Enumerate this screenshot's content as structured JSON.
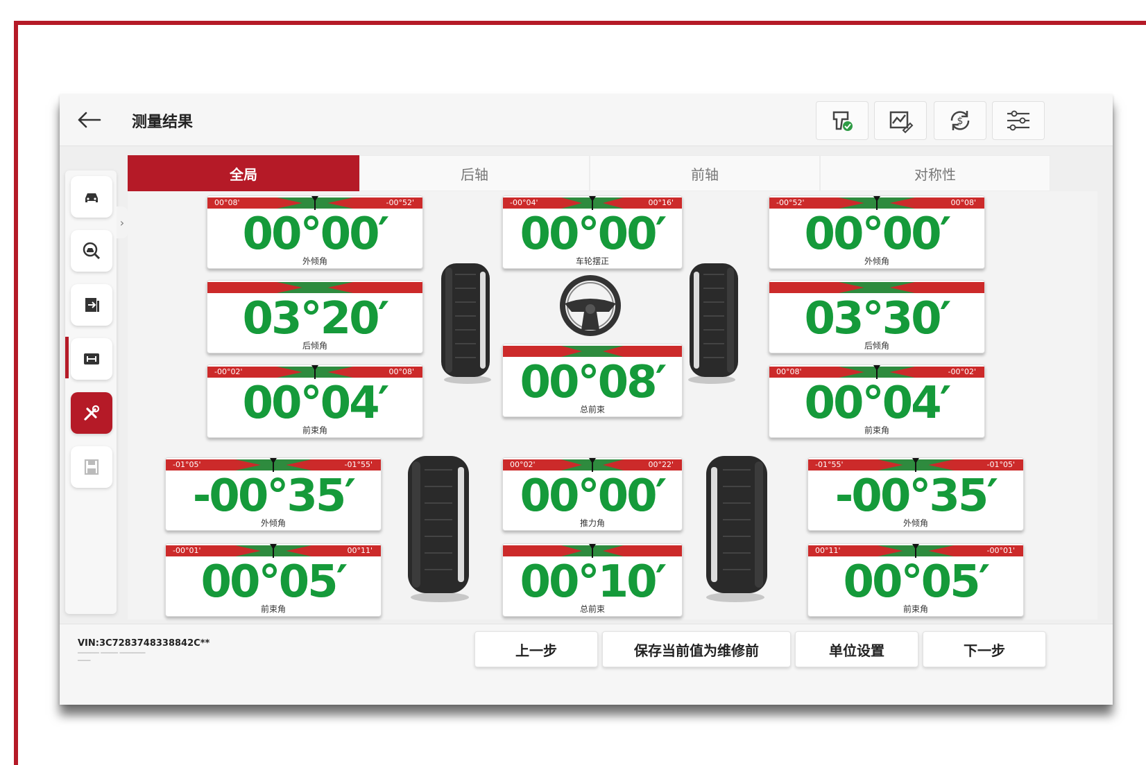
{
  "header": {
    "title": "测量结果"
  },
  "tools": [
    "tool-check-icon",
    "chart-edit-icon",
    "sync-icon",
    "settings-sliders-icon"
  ],
  "sidebar": {
    "items": [
      "car-icon",
      "car-search-icon",
      "export-icon",
      "axle-icon",
      "wrench-tools-icon",
      "save-icon"
    ],
    "active": 4
  },
  "tabs": [
    {
      "label": "全局",
      "active": true
    },
    {
      "label": "后轴",
      "active": false
    },
    {
      "label": "前轴",
      "active": false
    },
    {
      "label": "对称性",
      "active": false
    }
  ],
  "measurements": {
    "lf_camber": {
      "value": "00°00′",
      "label": "外倾角",
      "tol_left": "00°08'",
      "tol_right": "-00°52'"
    },
    "lf_caster": {
      "value": "03°20′",
      "label": "后倾角",
      "tol_left": "",
      "tol_right": ""
    },
    "lf_toe": {
      "value": "00°04′",
      "label": "前束角",
      "tol_left": "-00°02'",
      "tol_right": "00°08'"
    },
    "wheel_center": {
      "value": "00°00′",
      "label": "车轮摆正",
      "tol_left": "-00°04'",
      "tol_right": "00°16'"
    },
    "front_total_toe": {
      "value": "00°08′",
      "label": "总前束",
      "tol_left": "",
      "tol_right": ""
    },
    "rf_camber": {
      "value": "00°00′",
      "label": "外倾角",
      "tol_left": "-00°52'",
      "tol_right": "00°08'"
    },
    "rf_caster": {
      "value": "03°30′",
      "label": "后倾角",
      "tol_left": "",
      "tol_right": ""
    },
    "rf_toe": {
      "value": "00°04′",
      "label": "前束角",
      "tol_left": "00°08'",
      "tol_right": "-00°02'"
    },
    "lr_camber": {
      "value": "-00°35′",
      "label": "外倾角",
      "tol_left": "-01°05'",
      "tol_right": "-01°55'"
    },
    "lr_toe": {
      "value": "00°05′",
      "label": "前束角",
      "tol_left": "-00°01'",
      "tol_right": "00°11'"
    },
    "thrust": {
      "value": "00°00′",
      "label": "推力角",
      "tol_left": "00°02'",
      "tol_right": "00°22'"
    },
    "rear_total_toe": {
      "value": "00°10′",
      "label": "总前束",
      "tol_left": "",
      "tol_right": ""
    },
    "rr_camber": {
      "value": "-00°35′",
      "label": "外倾角",
      "tol_left": "-01°55'",
      "tol_right": "-01°05'"
    },
    "rr_toe": {
      "value": "00°05′",
      "label": "前束角",
      "tol_left": "00°11'",
      "tol_right": "-00°01'"
    }
  },
  "footer": {
    "vin": "VIN:3C7283748338842C**",
    "buttons": {
      "prev": "上一步",
      "save_before": "保存当前值为维修前",
      "unit_settings": "单位设置",
      "next": "下一步"
    }
  },
  "colors": {
    "accent": "#b51a27",
    "value_green": "#159a3a",
    "tol_red": "#cc2a2a",
    "band_green": "#2e8b3e"
  }
}
